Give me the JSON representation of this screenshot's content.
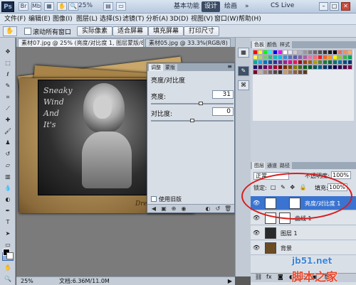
{
  "titlebar": {
    "logo": "Ps",
    "zoom": "25%",
    "workspaces": [
      "基本功能",
      "设计",
      "绘画"
    ],
    "active_workspace": "设计",
    "more": "»",
    "cslive": "CS Live",
    "win_min": "–",
    "win_max": "□",
    "win_close": "✕"
  },
  "menubar": {
    "items": [
      "文件(F)",
      "编辑(E)",
      "图像(I)",
      "图层(L)",
      "选择(S)",
      "滤镜(T)",
      "分析(A)",
      "3D(D)",
      "视图(V)",
      "窗口(W)",
      "帮助(H)"
    ]
  },
  "options": {
    "scroll_all_label": "滚动所有窗口",
    "buttons": [
      "实际像素",
      "适合屏幕",
      "填充屏幕",
      "打印尺寸"
    ]
  },
  "tabs": [
    {
      "label": "素材07.jpg @ 25% (亮度/对比度 1, 图层蒙版/8)",
      "active": true
    },
    {
      "label": "素材05.jpg @ 33.3%(RGB/8)",
      "active": false
    }
  ],
  "canvas_text": {
    "chalk_lines": [
      "Sneaky",
      "Wind",
      "And",
      "It's"
    ],
    "signature": "Dream Amen"
  },
  "adjustments": {
    "tabs": [
      "调整",
      "蒙版"
    ],
    "title": "亮度/对比度",
    "brightness_label": "亮度:",
    "brightness_value": "31",
    "contrast_label": "对比度:",
    "contrast_value": "0",
    "legacy_label": "使用旧版",
    "brightness_level": 0.6,
    "contrast_level": 0.5
  },
  "status": {
    "zoom": "25%",
    "doc_info": "文档:6.36M/11.0M"
  },
  "panels": {
    "color_tabs": [
      "色板",
      "颜色",
      "样式"
    ],
    "layer_tabs": [
      "图层",
      "通道",
      "路径"
    ],
    "blend_mode": "正常",
    "opacity_label": "不透明度:",
    "opacity_value": "100%",
    "lock_label": "锁定:",
    "lock_icons": "□ ✎ ✥ 🔒",
    "fill_label": "填充:",
    "fill_value": "100%",
    "layers": [
      {
        "name": "亮度/对比度 1",
        "selected": true,
        "thumb_color": "#ffffff"
      },
      {
        "name": "曲线 1",
        "selected": false,
        "thumb_color": "#ffffff"
      },
      {
        "name": "图层 1",
        "selected": false,
        "thumb_color": "#2a2a2a"
      },
      {
        "name": "背景",
        "selected": false,
        "thumb_color": "#6b4c22"
      }
    ]
  },
  "swatch_colors": [
    "#ff0000",
    "#ffff00",
    "#00ff00",
    "#00ffff",
    "#0000ff",
    "#ff00ff",
    "#ffffff",
    "#e6e6e6",
    "#cccccc",
    "#b3b3b3",
    "#999999",
    "#808080",
    "#666666",
    "#4d4d4d",
    "#333333",
    "#1a1a1a",
    "#000000",
    "#f26c4f",
    "#f68e55",
    "#fbaf5c",
    "#fff467",
    "#acd372",
    "#7cc576",
    "#3bb878",
    "#1abbb4",
    "#00bff3",
    "#438ccb",
    "#5574b9",
    "#605ca8",
    "#855fa8",
    "#a763a8",
    "#f06ea9",
    "#f26d7d",
    "#ed1c24",
    "#f26522",
    "#f7941d",
    "#fff200",
    "#8dc63f",
    "#39b54a",
    "#00a651",
    "#00a99d",
    "#00aeef",
    "#0072bc",
    "#0054a6",
    "#2e3192",
    "#662d91",
    "#92278f",
    "#ec008c",
    "#ed145b",
    "#9e0b0f",
    "#a0410d",
    "#a36209",
    "#aba000",
    "#598527",
    "#1a7b30",
    "#007236",
    "#00746b",
    "#0076a3",
    "#004b80",
    "#003471",
    "#1b1464",
    "#440e62",
    "#630460",
    "#9e005d",
    "#9e0039",
    "#790000",
    "#7b2e00",
    "#7d4900",
    "#827b00",
    "#406618",
    "#005e20",
    "#005826",
    "#005952",
    "#005b7f",
    "#003663",
    "#002157",
    "#0d004c",
    "#32004b",
    "#4b0049",
    "#7b0046",
    "#7a0026",
    "#c7b299",
    "#998675",
    "#736357",
    "#534741",
    "#37302d",
    "#c69c6d",
    "#a67c52",
    "#8c6239",
    "#754c24",
    "#603913"
  ],
  "watermark": {
    "site": "jb51.net",
    "name": "脚本之家"
  }
}
